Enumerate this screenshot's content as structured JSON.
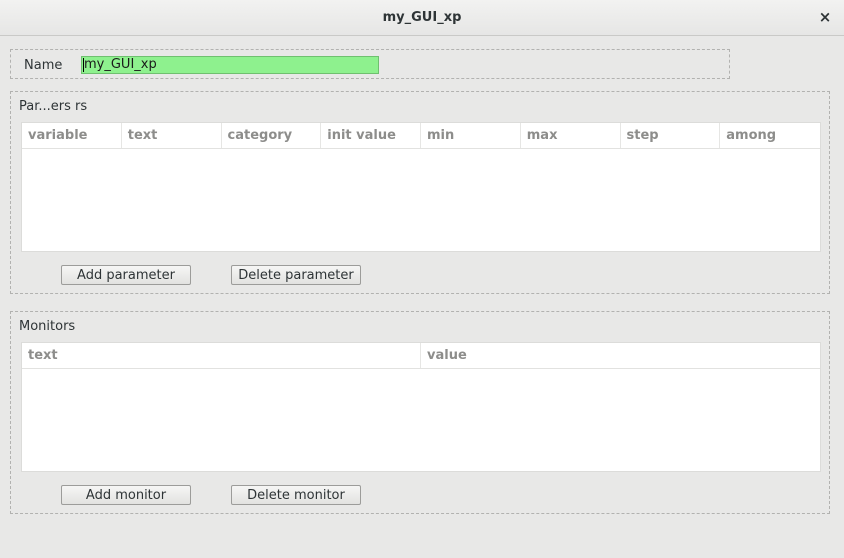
{
  "window": {
    "title": "my_GUI_xp",
    "close_glyph": "×"
  },
  "name_section": {
    "label": "Name",
    "value": "my_GUI_xp"
  },
  "parameters": {
    "label": "Par...ers   rs",
    "columns": [
      "variable",
      "text",
      "category",
      "init value",
      "min",
      "max",
      "step",
      "among"
    ],
    "add_label": "Add parameter",
    "delete_label": "Delete parameter"
  },
  "monitors": {
    "label": "Monitors",
    "columns": [
      "text",
      "value"
    ],
    "add_label": "Add monitor",
    "delete_label": "Delete monitor"
  },
  "colors": {
    "name_field_bg": "#8ef18e",
    "background": "#e8e8e7"
  }
}
